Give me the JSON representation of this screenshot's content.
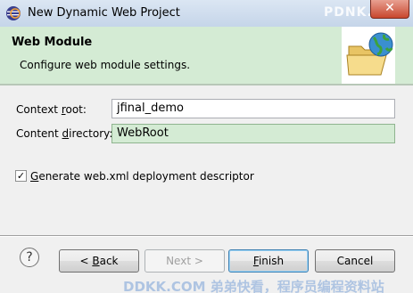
{
  "window": {
    "title": "New Dynamic Web Project",
    "close_glyph": "✕",
    "watermark_top": "PDNK.fi"
  },
  "banner": {
    "heading": "Web Module",
    "description": "Configure web module settings.",
    "icon": "folder-globe-icon"
  },
  "form": {
    "context_root": {
      "label_pre": "Context ",
      "label_accel": "r",
      "label_post": "oot:",
      "value": "jfinal_demo"
    },
    "content_directory": {
      "label_pre": "Content ",
      "label_accel": "d",
      "label_post": "irectory:",
      "value": "WebRoot"
    },
    "generate_descriptor": {
      "checked": true,
      "check_glyph": "✓",
      "label_accel": "G",
      "label_post": "enerate web.xml deployment descriptor"
    }
  },
  "buttons": {
    "help": "?",
    "back": {
      "pre": "< ",
      "accel": "B",
      "post": "ack"
    },
    "next": {
      "label": "Next >",
      "enabled": false
    },
    "finish": {
      "accel": "F",
      "post": "inish"
    },
    "cancel": "Cancel"
  },
  "watermark_bottom": "DDKK.COM 弟弟快看，程序员编程资料站"
}
